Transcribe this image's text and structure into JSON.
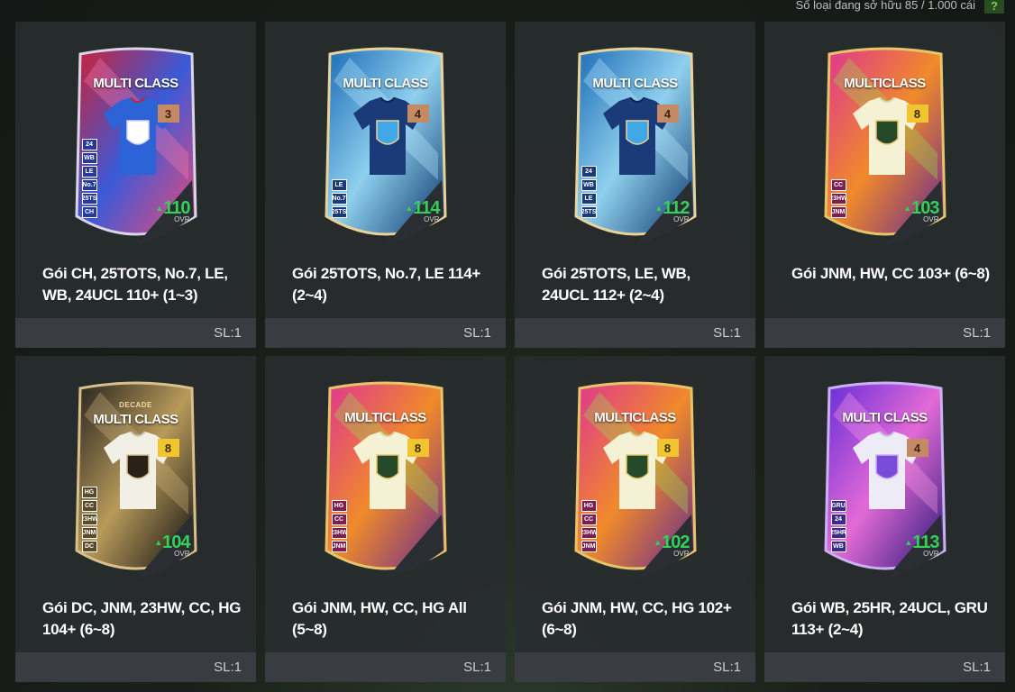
{
  "header": {
    "owned_label": "Số loại đang sở hữu   85 / 1.000 cái",
    "help_label": "?"
  },
  "colors": {
    "ovr_green": "#33d05a",
    "panel_bg": "#282c2e",
    "footer_bg": "#3a3e42"
  },
  "packs": [
    {
      "name": "Gói CH, 25TOTS, No.7, LE, WB, 24UCL 110+ (1~3)",
      "quantity": "SL:1",
      "card": {
        "class_label": "MULTI CLASS",
        "decade_label": "",
        "grade": "3",
        "grade_color": "bronze",
        "ovr": "110",
        "ovr_label": "OVR",
        "tags": [
          "24",
          "WB",
          "LE",
          "No.7",
          "25TS",
          "CH"
        ],
        "theme": "red-blue"
      }
    },
    {
      "name": "Gói 25TOTS, No.7, LE 114+ (2~4)",
      "quantity": "SL:1",
      "card": {
        "class_label": "MULTI CLASS",
        "decade_label": "",
        "grade": "4",
        "grade_color": "bronze",
        "ovr": "114",
        "ovr_label": "OVR",
        "tags": [
          "LE",
          "No.7",
          "25TS"
        ],
        "theme": "blue"
      }
    },
    {
      "name": "Gói 25TOTS, LE, WB, 24UCL 112+ (2~4)",
      "quantity": "SL:1",
      "card": {
        "class_label": "MULTI CLASS",
        "decade_label": "",
        "grade": "4",
        "grade_color": "bronze",
        "ovr": "112",
        "ovr_label": "OVR",
        "tags": [
          "24",
          "WB",
          "LE",
          "25TS"
        ],
        "theme": "blue"
      }
    },
    {
      "name": "Gói JNM, HW, CC 103+ (6~8)",
      "quantity": "SL:1",
      "card": {
        "class_label": "MULTICLASS",
        "decade_label": "",
        "grade": "8",
        "grade_color": "gold",
        "ovr": "103",
        "ovr_label": "OVR",
        "tags": [
          "CC",
          "23HW",
          "JNM"
        ],
        "theme": "pink-green"
      }
    },
    {
      "name": "Gói DC, JNM, 23HW, CC, HG 104+ (6~8)",
      "quantity": "SL:1",
      "card": {
        "class_label": "MULTI CLASS",
        "decade_label": "DECADE",
        "grade": "8",
        "grade_color": "gold",
        "ovr": "104",
        "ovr_label": "OVR",
        "tags": [
          "HG",
          "CC",
          "23HW",
          "JNM",
          "DC"
        ],
        "theme": "black-gold"
      }
    },
    {
      "name": "Gói JNM, HW, CC, HG All (5~8)",
      "quantity": "SL:1",
      "card": {
        "class_label": "MULTICLASS",
        "decade_label": "",
        "grade": "8",
        "grade_color": "gold",
        "ovr": "",
        "ovr_label": "",
        "tags": [
          "HG",
          "CC",
          "23HW",
          "JNM"
        ],
        "theme": "pink-green"
      }
    },
    {
      "name": "Gói JNM, HW, CC, HG 102+ (6~8)",
      "quantity": "SL:1",
      "card": {
        "class_label": "MULTICLASS",
        "decade_label": "",
        "grade": "8",
        "grade_color": "gold",
        "ovr": "102",
        "ovr_label": "OVR",
        "tags": [
          "HG",
          "CC",
          "23HW",
          "JNM"
        ],
        "theme": "pink-green"
      }
    },
    {
      "name": "Gói WB, 25HR, 24UCL, GRU 113+ (2~4)",
      "quantity": "SL:1",
      "card": {
        "class_label": "MULTI CLASS",
        "decade_label": "",
        "grade": "4",
        "grade_color": "bronze",
        "ovr": "113",
        "ovr_label": "OVR",
        "tags": [
          "GRU",
          "24",
          "25HR",
          "WB"
        ],
        "theme": "purple"
      }
    }
  ]
}
